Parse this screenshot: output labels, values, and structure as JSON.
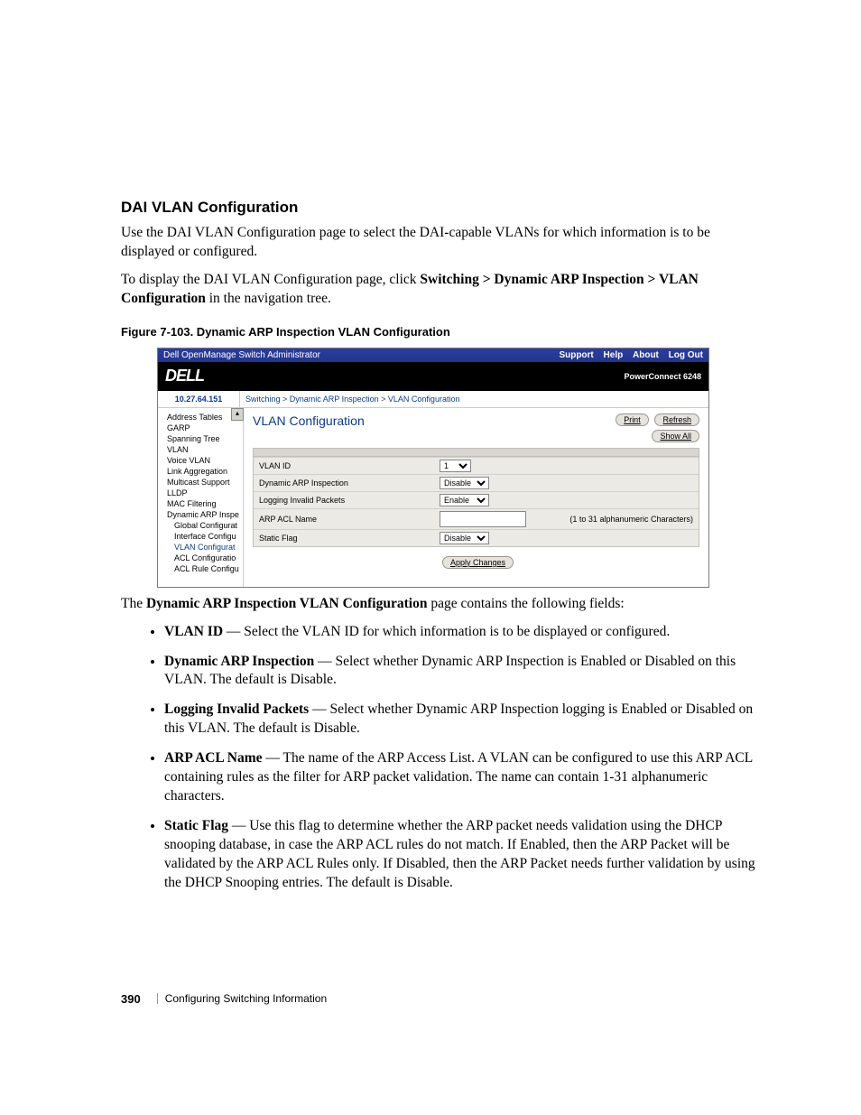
{
  "heading": "DAI VLAN Configuration",
  "intro1": "Use the DAI VLAN Configuration page to select the DAI-capable VLANs for which information is to be displayed or configured.",
  "intro2_pre": "To display the DAI VLAN Configuration page, click ",
  "intro2_bold": "Switching > Dynamic ARP Inspection > VLAN Configuration",
  "intro2_post": " in the navigation tree.",
  "figure_label": "Figure 7-103.    Dynamic ARP Inspection VLAN Configuration",
  "shot": {
    "titlebar_left": "Dell OpenManage Switch Administrator",
    "titlebar_links": [
      "Support",
      "Help",
      "About",
      "Log Out"
    ],
    "logo": "DELL",
    "model": "PowerConnect 6248",
    "ip": "10.27.64.151",
    "crumb": "Switching > Dynamic ARP Inspection > VLAN Configuration",
    "sidebar_items": [
      "Address Tables",
      "GARP",
      "Spanning Tree",
      "VLAN",
      "Voice VLAN",
      "Link Aggregation",
      "Multicast Support",
      "LLDP",
      "MAC Filtering",
      "Dynamic ARP Inspe"
    ],
    "sidebar_sub": [
      "Global Configurat",
      "Interface Configu",
      "VLAN Configurat",
      "ACL Configuratio",
      "ACL Rule Configu"
    ],
    "page_title": "VLAN Configuration",
    "btn_print": "Print",
    "btn_refresh": "Refresh",
    "btn_showall": "Show All",
    "rows": {
      "vlan_id": "VLAN ID",
      "vlan_id_val": "1",
      "dai": "Dynamic ARP Inspection",
      "dai_val": "Disable",
      "log": "Logging Invalid Packets",
      "log_val": "Enable",
      "acl": "ARP ACL Name",
      "acl_note": "(1 to 31 alphanumeric Characters)",
      "flag": "Static Flag",
      "flag_val": "Disable"
    },
    "apply": "Apply Changes"
  },
  "after_shot_pre": "The ",
  "after_shot_bold": "Dynamic ARP Inspection VLAN Configuration",
  "after_shot_post": " page contains the following fields:",
  "fields": [
    {
      "term": "VLAN ID",
      "desc": " — Select the VLAN ID for which information is to be displayed or configured."
    },
    {
      "term": "Dynamic ARP Inspection",
      "desc": " — Select whether Dynamic ARP Inspection is Enabled or Disabled on this VLAN. The default is Disable."
    },
    {
      "term": "Logging Invalid Packets",
      "desc": " — Select whether Dynamic ARP Inspection logging is Enabled or Disabled on this VLAN. The default is Disable."
    },
    {
      "term": "ARP ACL Name",
      "desc": " — The name of the ARP Access List. A VLAN can be configured to use this ARP ACL containing rules as the filter for ARP packet validation. The name can contain 1-31 alphanumeric characters."
    },
    {
      "term": "Static Flag",
      "desc": " — Use this flag to determine whether the ARP packet needs validation using the DHCP snooping database, in case the ARP ACL rules do not match. If Enabled, then the ARP Packet will be validated by the ARP ACL Rules only. If Disabled, then the ARP Packet needs further validation by using the DHCP Snooping entries. The default is Disable."
    }
  ],
  "footer_page": "390",
  "footer_chapter": "Configuring Switching Information"
}
